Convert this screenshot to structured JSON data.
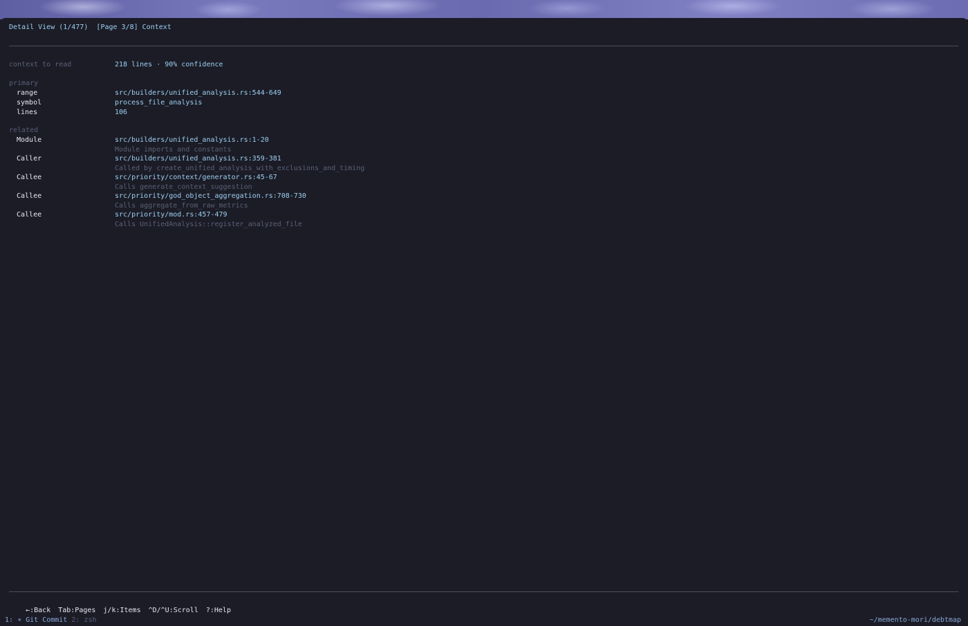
{
  "header": {
    "title": "Detail View (1/477)  [Page 3/8] Context"
  },
  "summary": {
    "label": "context to read",
    "value": "218 lines · 90% confidence"
  },
  "primary": {
    "heading": "primary",
    "rows": [
      {
        "label": "range",
        "value": "src/builders/unified_analysis.rs:544-649"
      },
      {
        "label": "symbol",
        "value": "process_file_analysis"
      },
      {
        "label": "lines",
        "value": "106"
      }
    ]
  },
  "related": {
    "heading": "related",
    "items": [
      {
        "label": "Module",
        "path": "src/builders/unified_analysis.rs:1-20",
        "description": "Module imports and constants"
      },
      {
        "label": "Caller",
        "path": "src/builders/unified_analysis.rs:359-381",
        "description": "Called by create_unified_analysis_with_exclusions_and_timing"
      },
      {
        "label": "Callee",
        "path": "src/priority/context/generator.rs:45-67",
        "description": "Calls generate_context_suggestion"
      },
      {
        "label": "Callee",
        "path": "src/priority/god_object_aggregation.rs:708-730",
        "description": "Calls aggregate_from_raw_metrics"
      },
      {
        "label": "Callee",
        "path": "src/priority/mod.rs:457-479",
        "description": "Calls UnifiedAnalysis::register_analyzed_file"
      }
    ]
  },
  "keybindings": [
    "←:Back",
    "Tab:Pages",
    "j/k:Items",
    "^D/^U:Scroll",
    "?:Help"
  ],
  "statusbar": {
    "window1_index": "1:",
    "window1_name": "∗ Git Commit",
    "window2_index": "2:",
    "window2_name": "zsh",
    "path": "~/memento-mori/debtmap"
  }
}
